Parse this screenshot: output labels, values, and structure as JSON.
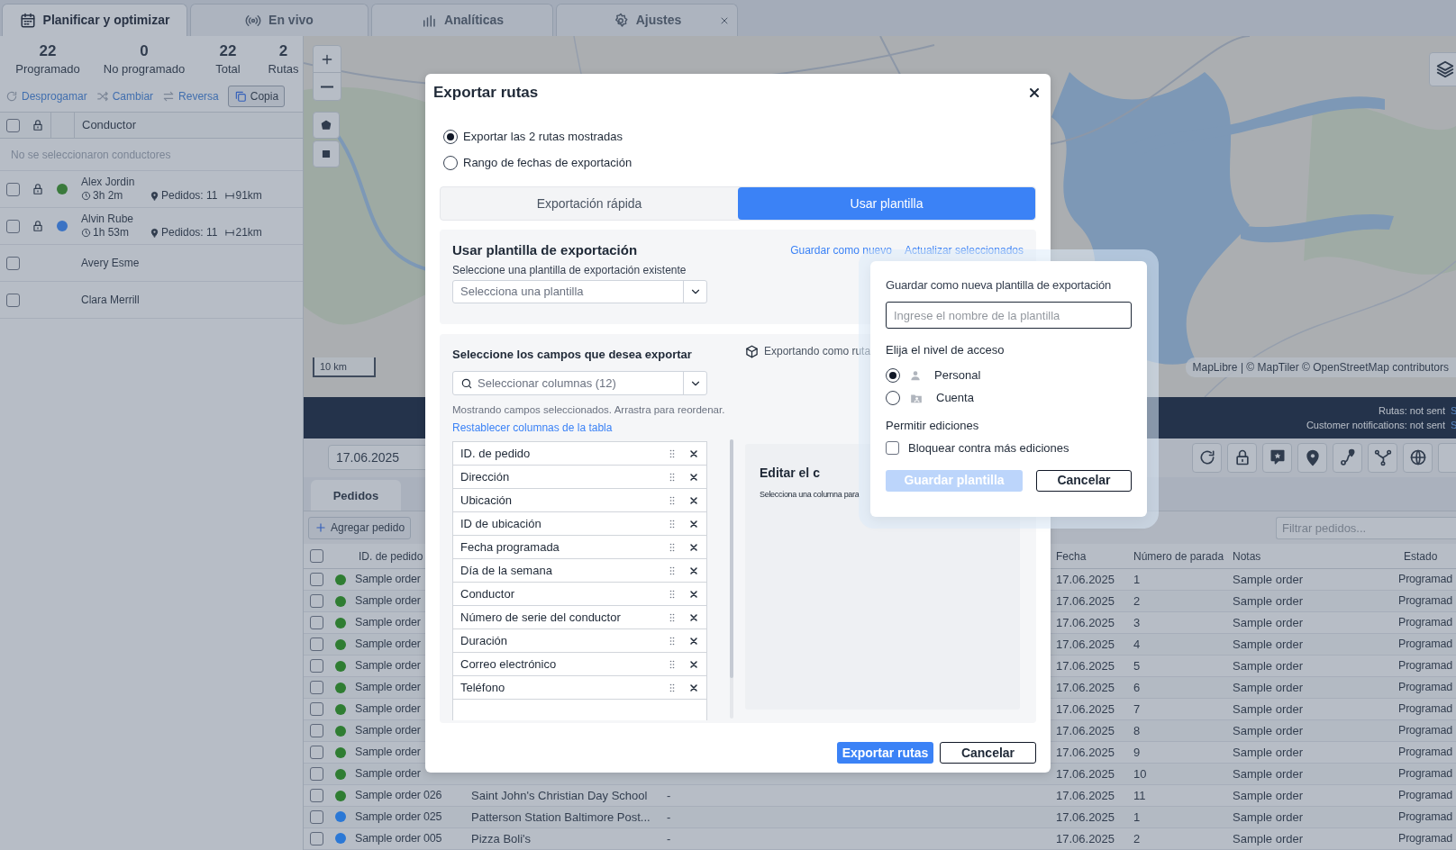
{
  "tabs": [
    {
      "label": "Planificar y optimizar",
      "selected": true,
      "closable": false
    },
    {
      "label": "En vivo",
      "selected": false,
      "closable": false
    },
    {
      "label": "Analíticas",
      "selected": false,
      "closable": false
    },
    {
      "label": "Ajustes",
      "selected": false,
      "closable": true
    }
  ],
  "stats": [
    {
      "value": "22",
      "label": "Programado"
    },
    {
      "value": "0",
      "label": "No programado"
    },
    {
      "value": "22",
      "label": "Total"
    },
    {
      "value": "2",
      "label": "Rutas"
    }
  ],
  "actions": [
    {
      "label": "Desprogamar",
      "kind": "link"
    },
    {
      "label": "Cambiar",
      "kind": "link"
    },
    {
      "label": "Reversa",
      "kind": "link"
    },
    {
      "label": "Copia",
      "kind": "button"
    }
  ],
  "drivers": {
    "header": "Conductor",
    "header_checked": false,
    "empty_note": "No se seleccionaron conductores",
    "rows": [
      {
        "name": "Alex Jordin",
        "time": "3h 2m",
        "orders": "Pedidos: 11",
        "distance": "91km",
        "color": "#3a7a3c",
        "locked": true,
        "checked": false
      },
      {
        "name": "Alvin Rube",
        "time": "1h 53m",
        "orders": "Pedidos: 11",
        "distance": "21km",
        "color": "#3b73c4",
        "locked": true,
        "checked": false
      },
      {
        "name": "Avery Esme",
        "locked": false,
        "checked": false
      },
      {
        "name": "Clara Merrill",
        "locked": false,
        "checked": false
      }
    ]
  },
  "map": {
    "scale": "10 km",
    "attribution": "MapLibre | © MapTiler © OpenStreetMap contributors"
  },
  "status_bar": [
    {
      "text": "Rutas: not sent",
      "link": "S"
    },
    {
      "text": "Customer notifications: not sent",
      "link": "S"
    }
  ],
  "orders": {
    "date": "17.06.2025",
    "tab": "Pedidos",
    "add_button": "Agregar pedido",
    "filter_placeholder": "Filtrar pedidos...",
    "columns": {
      "id": "ID. de pedido",
      "date": "Fecha",
      "stop": "Número de parada",
      "notes": "Notas",
      "status": "Estado"
    },
    "header_checked": false,
    "rows": [
      {
        "id": "Sample order",
        "date": "17.06.2025",
        "stop": "1",
        "notes": "Sample order",
        "status": "Programad",
        "color": "#2f7d32",
        "checked": false
      },
      {
        "id": "Sample order",
        "date": "17.06.2025",
        "stop": "2",
        "notes": "Sample order",
        "status": "Programad",
        "color": "#2f7d32",
        "checked": false
      },
      {
        "id": "Sample order",
        "date": "17.06.2025",
        "stop": "3",
        "notes": "Sample order",
        "status": "Programad",
        "color": "#2f7d32",
        "checked": false
      },
      {
        "id": "Sample order",
        "date": "17.06.2025",
        "stop": "4",
        "notes": "Sample order",
        "status": "Programad",
        "color": "#2f7d32",
        "checked": false
      },
      {
        "id": "Sample order",
        "date": "17.06.2025",
        "stop": "5",
        "notes": "Sample order",
        "status": "Programad",
        "color": "#2f7d32",
        "checked": false
      },
      {
        "id": "Sample order",
        "date": "17.06.2025",
        "stop": "6",
        "notes": "Sample order",
        "status": "Programad",
        "color": "#2f7d32",
        "checked": false
      },
      {
        "id": "Sample order",
        "date": "17.06.2025",
        "stop": "7",
        "notes": "Sample order",
        "status": "Programad",
        "color": "#2f7d32",
        "checked": false
      },
      {
        "id": "Sample order",
        "date": "17.06.2025",
        "stop": "8",
        "notes": "Sample order",
        "status": "Programad",
        "color": "#2f7d32",
        "checked": false
      },
      {
        "id": "Sample order",
        "date": "17.06.2025",
        "stop": "9",
        "notes": "Sample order",
        "status": "Programad",
        "color": "#2f7d32",
        "checked": false
      },
      {
        "id": "Sample order",
        "date": "17.06.2025",
        "stop": "10",
        "notes": "Sample order",
        "status": "Programad",
        "color": "#2f7d32",
        "checked": false
      },
      {
        "id": "Sample order 026",
        "address": "Saint John's Christian Day School",
        "column_3": "-",
        "date": "17.06.2025",
        "stop": "11",
        "notes": "Sample order",
        "status": "Programad",
        "color": "#2f7d32",
        "checked": false
      },
      {
        "id": "Sample order 025",
        "address": "Patterson Station Baltimore Post...",
        "column_3": "-",
        "date": "17.06.2025",
        "stop": "1",
        "notes": "Sample order",
        "status": "Programad",
        "color": "#2b78d6",
        "checked": false
      },
      {
        "id": "Sample order 005",
        "address": "Pizza Boli's",
        "column_3": "-",
        "date": "17.06.2025",
        "stop": "2",
        "notes": "Sample order",
        "status": "Programad",
        "color": "#2b78d6",
        "checked": false
      }
    ]
  },
  "modal": {
    "title": "Exportar rutas",
    "scope_options": [
      {
        "label": "Exportar las 2 rutas mostradas",
        "selected": true
      },
      {
        "label": "Rango de fechas de exportación",
        "selected": false
      }
    ],
    "modes": [
      {
        "label": "Exportación rápida",
        "selected": false
      },
      {
        "label": "Usar plantilla",
        "selected": true
      }
    ],
    "template": {
      "heading": "Usar plantilla de exportación",
      "subtitle": "Seleccione una plantilla de exportación existente",
      "select_placeholder": "Selecciona una plantilla",
      "links": [
        "Guardar como nuevo",
        "Actualizar seleccionados"
      ]
    },
    "fields": {
      "heading": "Seleccione los campos que desea exportar",
      "search_placeholder": "Seleccionar columnas (12)",
      "hint": "Mostrando campos seleccionados. Arrastra para reordenar.",
      "reset_link": "Restablecer columnas de la tabla",
      "items": [
        "ID. de pedido",
        "Dirección",
        "Ubicación",
        "ID de ubicación",
        "Fecha programada",
        "Día de la semana",
        "Conductor",
        "Número de serie del conductor",
        "Duración",
        "Correo electrónico",
        "Teléfono"
      ]
    },
    "exporting_note": "Exportando como ruta",
    "editor": {
      "heading": "Editar el c",
      "note": "Selecciona una columna para"
    },
    "buttons": [
      {
        "label": "Exportar rutas",
        "kind": "primary",
        "disabled": false
      },
      {
        "label": "Cancelar",
        "kind": "secondary",
        "disabled": false
      }
    ]
  },
  "popover": {
    "title": "Guardar como nueva plantilla de exportación",
    "name_placeholder": "Ingrese el nombre de la plantilla",
    "access_heading": "Elija el nivel de acceso",
    "access_options": [
      {
        "label": "Personal",
        "kind": "person",
        "selected": true
      },
      {
        "label": "Cuenta",
        "kind": "account",
        "selected": false
      }
    ],
    "edits_heading": "Permitir ediciones",
    "lock_option": {
      "label": "Bloquear contra más ediciones",
      "checked": false
    },
    "buttons": [
      {
        "label": "Guardar plantilla",
        "kind": "primary",
        "disabled": true
      },
      {
        "label": "Cancelar",
        "kind": "secondary",
        "disabled": false
      }
    ]
  }
}
